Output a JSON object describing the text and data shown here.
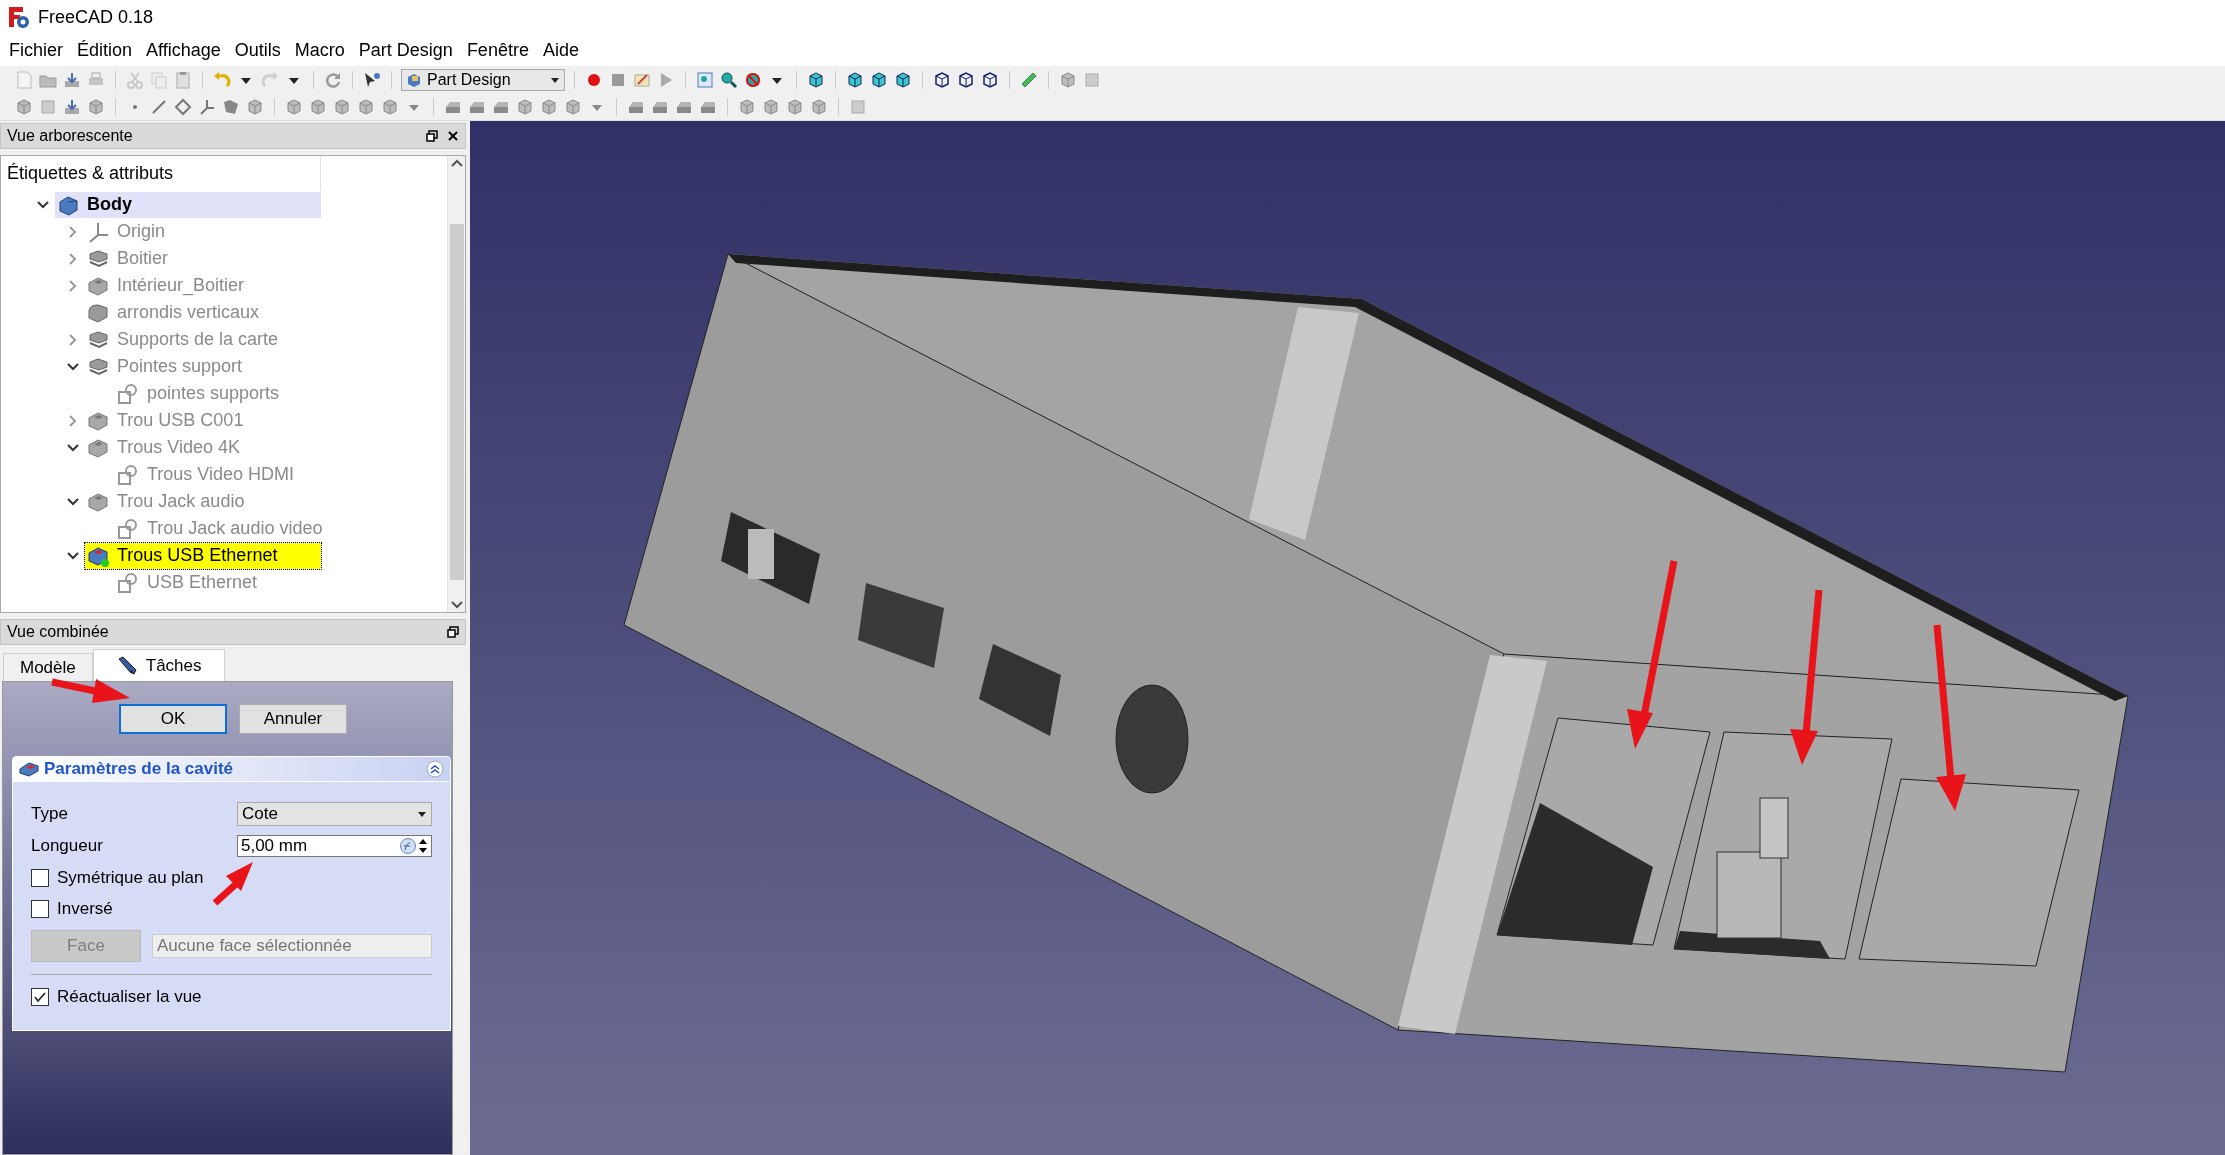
{
  "window": {
    "title": "FreeCAD 0.18"
  },
  "menu": [
    "Fichier",
    "Édition",
    "Affichage",
    "Outils",
    "Macro",
    "Part Design",
    "Fenêtre",
    "Aide"
  ],
  "toolbar": {
    "workbench": "Part Design"
  },
  "tree_panel": {
    "title": "Vue arborescente",
    "column_header": "Étiquettes & attributs",
    "items": [
      {
        "label": "Body",
        "kind": "body",
        "active": true,
        "selected": false,
        "hidden": false,
        "expanded": true,
        "children": [
          {
            "label": "Origin",
            "kind": "origin",
            "selected": false,
            "hidden": true,
            "expanded": false
          },
          {
            "label": "Boitier",
            "kind": "pad",
            "selected": false,
            "hidden": true,
            "expanded": false
          },
          {
            "label": "Intérieur_Boitier",
            "kind": "pocket",
            "selected": false,
            "hidden": true,
            "expanded": false
          },
          {
            "label": "arrondis verticaux",
            "kind": "fillet",
            "selected": false,
            "hidden": true
          },
          {
            "label": "Supports de la carte",
            "kind": "pad",
            "selected": false,
            "hidden": true,
            "expanded": false
          },
          {
            "label": "Pointes support",
            "kind": "pad",
            "selected": false,
            "hidden": true,
            "expanded": true,
            "children": [
              {
                "label": "pointes supports",
                "kind": "sketch",
                "selected": false,
                "hidden": true
              }
            ]
          },
          {
            "label": "Trou USB C001",
            "kind": "pocket",
            "selected": false,
            "hidden": true,
            "expanded": false
          },
          {
            "label": "Trous Video 4K",
            "kind": "pocket",
            "selected": false,
            "hidden": true,
            "expanded": true,
            "children": [
              {
                "label": "Trous Video HDMI",
                "kind": "sketch",
                "selected": false,
                "hidden": true
              }
            ]
          },
          {
            "label": "Trou Jack audio",
            "kind": "pocket",
            "selected": false,
            "hidden": true,
            "expanded": true,
            "children": [
              {
                "label": "Trou Jack audio video",
                "kind": "sketch",
                "selected": false,
                "hidden": true
              }
            ]
          },
          {
            "label": "Trous USB Ethernet",
            "kind": "pocket-edit",
            "selected": true,
            "hidden": false,
            "expanded": true,
            "children": [
              {
                "label": "USB Ethernet",
                "kind": "sketch",
                "selected": false,
                "hidden": true
              }
            ]
          }
        ]
      }
    ]
  },
  "combo_panel": {
    "title": "Vue combinée",
    "tabs": [
      {
        "label": "Modèle",
        "selected": false
      },
      {
        "label": "Tâches",
        "selected": true
      }
    ],
    "buttons": [
      {
        "label": "OK",
        "focused": true
      },
      {
        "label": "Annuler",
        "focused": false
      }
    ],
    "section": {
      "title": "Paramètres de la cavité",
      "type": {
        "label": "Type",
        "value": "Cote"
      },
      "length": {
        "label": "Longueur",
        "value": "5,00 mm"
      },
      "checkboxes": [
        {
          "label": "Symétrique au plan",
          "checked": false
        },
        {
          "label": "Inversé",
          "checked": false
        }
      ],
      "face_button": {
        "label": "Face",
        "disabled": true
      },
      "face_field": {
        "placeholder": "Aucune face sélectionnée",
        "disabled": true
      },
      "refresh": {
        "label": "Réactualiser la vue",
        "checked": true
      }
    }
  }
}
